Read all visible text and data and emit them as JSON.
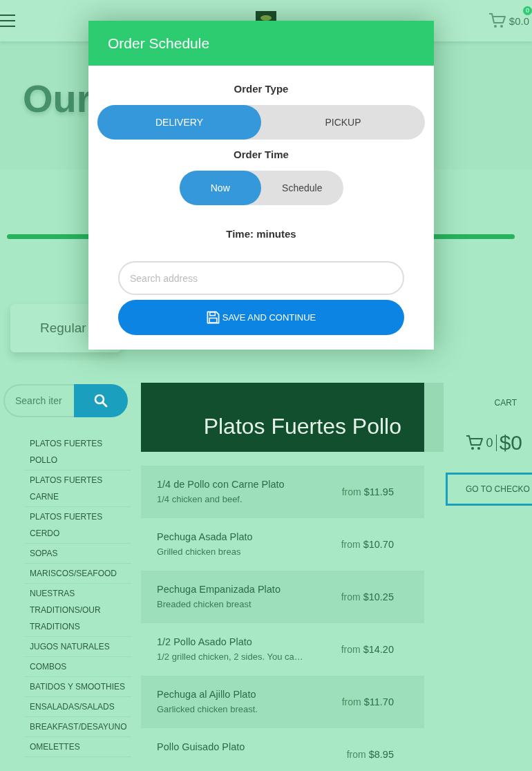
{
  "header": {
    "cart_total": "$0.0",
    "cart_count": "0"
  },
  "hero": {
    "title": "Our"
  },
  "menu_tabs": [
    {
      "label": "Regular"
    }
  ],
  "sidebar": {
    "search": {
      "placeholder": "Search iter"
    },
    "categories": [
      "PLATOS FUERTES POLLO",
      "PLATOS FUERTES CARNE",
      "PLATOS FUERTES CERDO",
      "SOPAS",
      "MARISCOS/SEAFOOD",
      "NUESTRAS TRADITIONS/OUR TRADITIONS",
      "JUGOS NATURALES",
      "COMBOS",
      "BATIDOS Y SMOOTHIES",
      "ENSALADAS/SALADS",
      "BREAKFAST/DESAYUNO",
      "OMELETTES"
    ]
  },
  "category": {
    "title": "Platos Fuertes Pollo",
    "items": [
      {
        "name": "1/4 de Pollo con Carne Plato",
        "description": "1/4 chicken and beef.",
        "price_prefix": "from",
        "price": "$11.95"
      },
      {
        "name": "Pechuga Asada Plato",
        "description": "Grilled chicken breas",
        "price_prefix": "from",
        "price": "$10.70"
      },
      {
        "name": "Pechuga Empanizada Plato",
        "description": "Breaded chicken breast",
        "price_prefix": "from",
        "price": "$10.25"
      },
      {
        "name": "1/2 Pollo Asado Plato",
        "description": "1/2 grilled chicken, 2 sides. You ca…",
        "price_prefix": "from",
        "price": "$14.20"
      },
      {
        "name": "Pechuga al Ajillo Plato",
        "description": "Garlicked chicken breast.",
        "price_prefix": "from",
        "price": "$11.70"
      },
      {
        "name": "Pollo Guisado Plato",
        "price_prefix": "from",
        "price": "$8.95"
      }
    ]
  },
  "cart": {
    "title": "CART",
    "count": "0",
    "total": "$0",
    "checkout_button": "GO TO CHECKO"
  },
  "modal": {
    "title": "Order Schedule",
    "order_type": {
      "label": "Order Type",
      "options": [
        {
          "label": "DELIVERY",
          "selected": true
        },
        {
          "label": "PICKUP",
          "selected": false
        }
      ]
    },
    "order_time": {
      "label": "Order Time",
      "options": [
        {
          "label": "Now",
          "selected": true
        },
        {
          "label": "Schedule",
          "selected": false
        }
      ]
    },
    "time_label": "Time: minutes",
    "address": {
      "placeholder": "Search address"
    },
    "save_button": "SAVE AND CONTINUE"
  }
}
